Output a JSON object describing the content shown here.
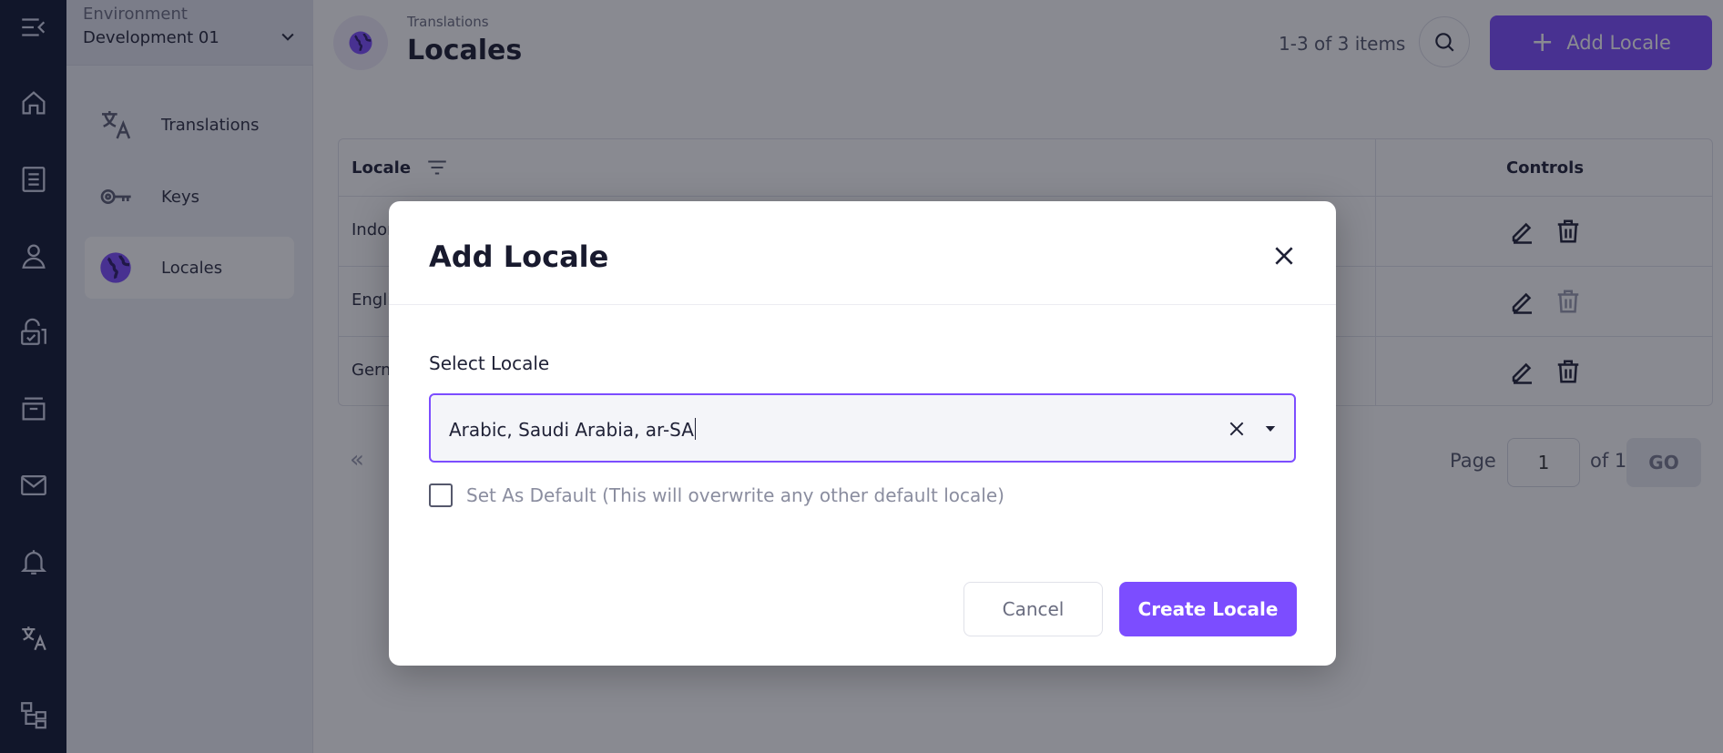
{
  "sidebar": {
    "environment_label": "Environment",
    "environment_value": "Development 01",
    "items": [
      {
        "label": "Translations",
        "icon": "translate-icon"
      },
      {
        "label": "Keys",
        "icon": "key-icon"
      },
      {
        "label": "Locales",
        "icon": "globe-icon",
        "active": true
      }
    ]
  },
  "rail": {
    "icons": [
      "menu-collapse-icon",
      "home-icon",
      "list-icon",
      "user-icon",
      "lock-icon",
      "archive-icon",
      "mail-icon",
      "bell-icon",
      "translate-icon",
      "hierarchy-icon"
    ]
  },
  "header": {
    "breadcrumb": "Translations",
    "title": "Locales",
    "count": "1-3 of 3 items",
    "add_button": "Add Locale"
  },
  "table": {
    "columns": [
      "Locale",
      "Controls"
    ],
    "rows": [
      {
        "locale": "Indon",
        "delete_enabled": true
      },
      {
        "locale": "Engli",
        "delete_enabled": false
      },
      {
        "locale": "Germ",
        "delete_enabled": true
      }
    ]
  },
  "pagination": {
    "first_symbol": "«",
    "page_label": "Page",
    "page_value": "1",
    "of_label": "of 1",
    "go_label": "GO"
  },
  "modal": {
    "title": "Add Locale",
    "field_label": "Select Locale",
    "selected_value": "Arabic, Saudi Arabia, ar-SA",
    "checkbox_label": "Set As Default (This will overwrite any other default locale)",
    "checkbox_checked": false,
    "cancel_label": "Cancel",
    "submit_label": "Create Locale"
  },
  "colors": {
    "accent": "#7c4dff",
    "rail_bg": "#0f1630"
  }
}
